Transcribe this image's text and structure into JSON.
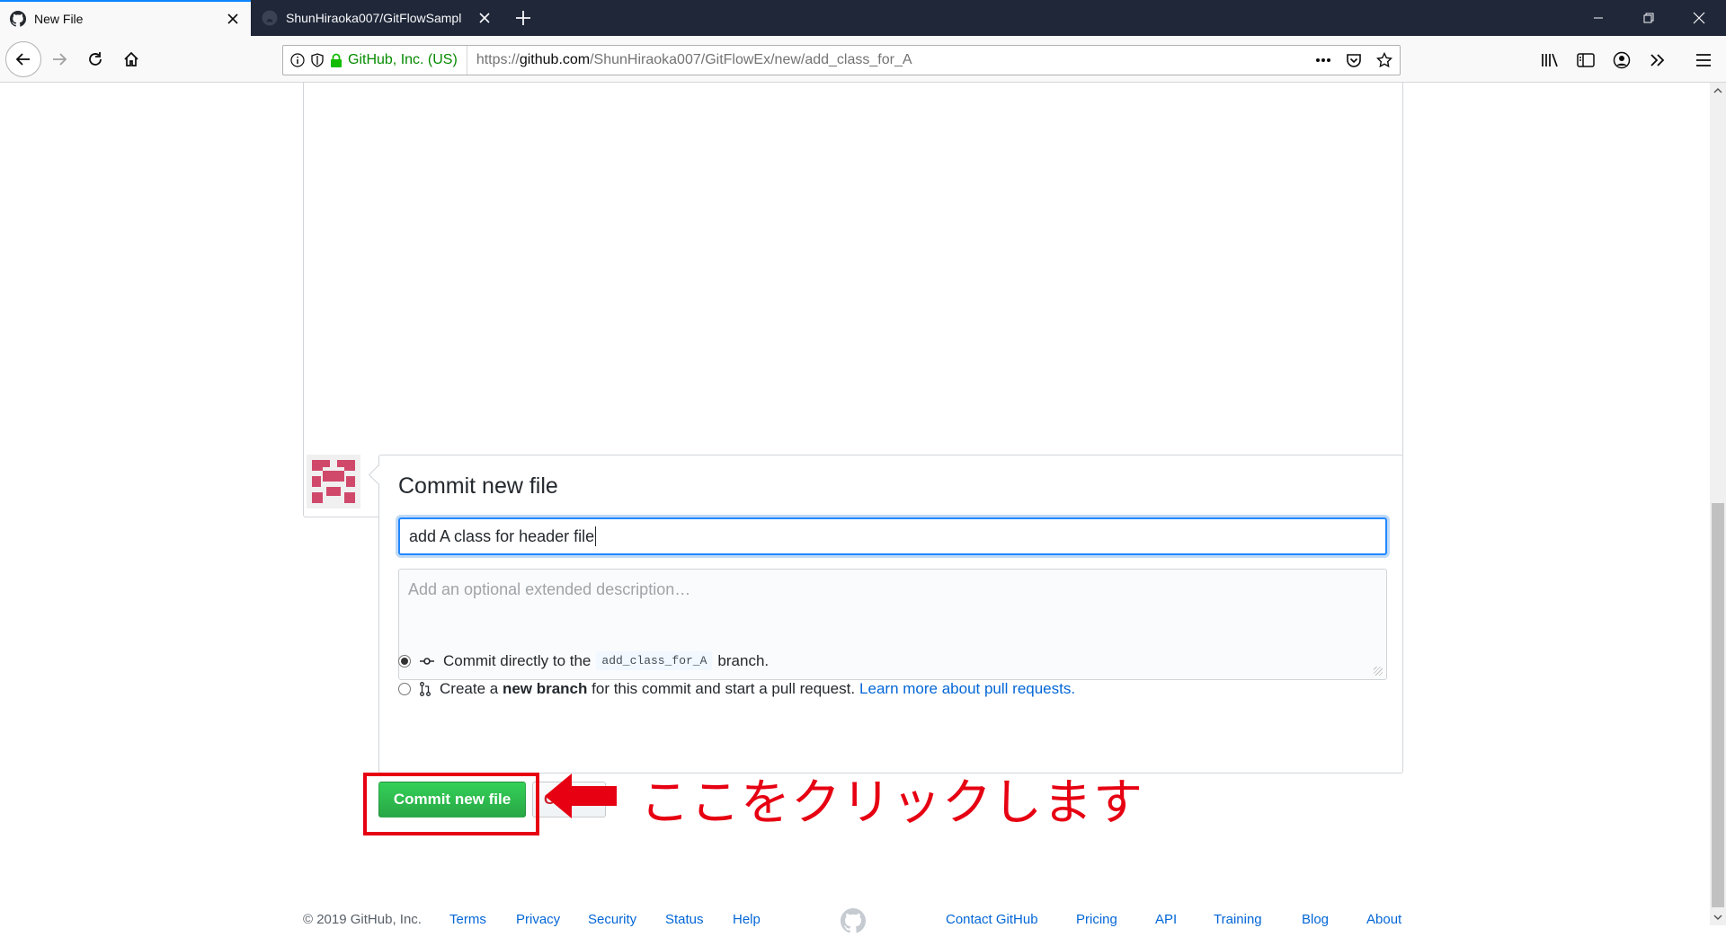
{
  "browser": {
    "tabs": [
      {
        "title": "New File",
        "favicon": "github-icon",
        "active": true
      },
      {
        "title": "ShunHiraoka007/GitFlowSampl",
        "favicon": "github-icon",
        "active": false
      }
    ],
    "url": {
      "identity_label": "GitHub, Inc. (US)",
      "prefix": "https://",
      "domain": "github.com",
      "path": "/ShunHiraoka007/GitFlowEx/new/add_class_for_A"
    }
  },
  "commit": {
    "heading": "Commit new file",
    "summary_value": "add A class for header file",
    "description_placeholder": "Add an optional extended description…",
    "option_direct": {
      "prefix": "Commit directly to the",
      "branch": "add_class_for_A",
      "suffix": "branch."
    },
    "option_new_branch": {
      "prefix": "Create a",
      "bold": "new branch",
      "suffix": "for this commit and start a pull request.",
      "link": "Learn more about pull requests."
    },
    "commit_button": "Commit new file",
    "cancel_button": "Cancel"
  },
  "annotation": {
    "text": "ここをクリックします",
    "color": "#e60012"
  },
  "footer": {
    "copyright": "© 2019 GitHub, Inc.",
    "left_links": [
      "Terms",
      "Privacy",
      "Security",
      "Status",
      "Help"
    ],
    "right_links": [
      "Contact GitHub",
      "Pricing",
      "API",
      "Training",
      "Blog",
      "About"
    ]
  },
  "colors": {
    "accent_blue": "#0366d6",
    "commit_green": "#28a745",
    "tabbar": "#1f2739"
  }
}
